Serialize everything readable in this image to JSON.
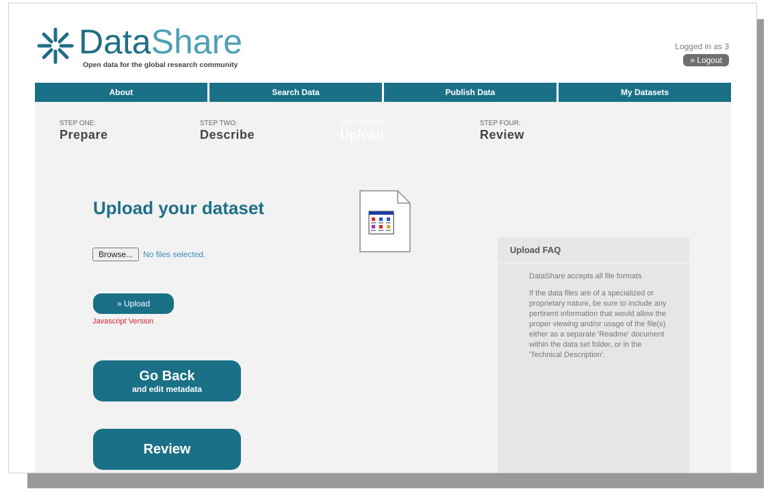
{
  "brand": {
    "name_dark": "Data",
    "name_light": "Share",
    "tagline": "Open data for the global research community"
  },
  "user": {
    "logged_in_text": "Logged in as 3",
    "logout_label": "» Logout"
  },
  "nav": {
    "items": [
      {
        "label": "About"
      },
      {
        "label": "Search Data"
      },
      {
        "label": "Publish Data"
      },
      {
        "label": "My Datasets"
      }
    ]
  },
  "steps": [
    {
      "label": "STEP ONE:",
      "name": "Prepare"
    },
    {
      "label": "STEP TWO:",
      "name": "Describe"
    },
    {
      "label": "STEP THREE:",
      "name": "Upload"
    },
    {
      "label": "STEP FOUR:",
      "name": "Review"
    }
  ],
  "upload": {
    "heading": "Upload your dataset",
    "browse_label": "Browse...",
    "no_files_text": "No files selected.",
    "upload_label": "» Upload",
    "js_version_label": "Javascript Version"
  },
  "buttons": {
    "go_back_title": "Go Back",
    "go_back_sub": "and edit metadata",
    "review_title": "Review"
  },
  "faq": {
    "title": "Upload FAQ",
    "p1": "DataShare accepts all file formats",
    "p2": "If the data files are of a specialized or proprietary nature, be sure to include any pertinent information that would allow the proper viewing and/or usage of the file(s) either as a separate 'Readme' document within the data set folder, or in the 'Technical Description'."
  },
  "colors": {
    "accent": "#1a7087",
    "brand_light": "#4f9fb6",
    "warning": "#d2233a"
  },
  "icons": {
    "logo": "asterisk-burst-icon",
    "broken_image": "broken-image-icon"
  }
}
